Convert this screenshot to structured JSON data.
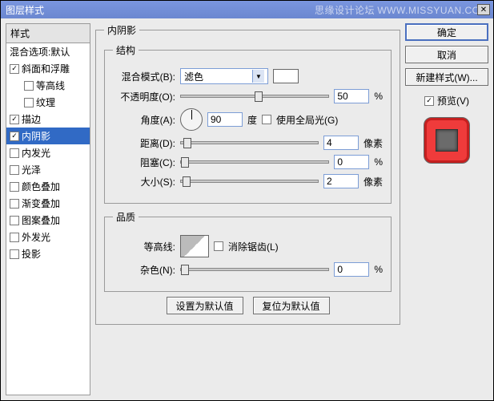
{
  "title": "图层样式",
  "watermark_text": "思缘设计论坛",
  "watermark_url": "WWW.MISSYUAN.COM",
  "styles": {
    "header": "样式",
    "blend_defaults": "混合选项:默认",
    "items": [
      {
        "label": "斜面和浮雕",
        "checked": true,
        "indent": false
      },
      {
        "label": "等高线",
        "checked": false,
        "indent": true
      },
      {
        "label": "纹理",
        "checked": false,
        "indent": true
      },
      {
        "label": "描边",
        "checked": true,
        "indent": false
      },
      {
        "label": "内阴影",
        "checked": true,
        "indent": false,
        "selected": true
      },
      {
        "label": "内发光",
        "checked": false,
        "indent": false
      },
      {
        "label": "光泽",
        "checked": false,
        "indent": false
      },
      {
        "label": "颜色叠加",
        "checked": false,
        "indent": false
      },
      {
        "label": "渐变叠加",
        "checked": false,
        "indent": false
      },
      {
        "label": "图案叠加",
        "checked": false,
        "indent": false
      },
      {
        "label": "外发光",
        "checked": false,
        "indent": false
      },
      {
        "label": "投影",
        "checked": false,
        "indent": false
      }
    ]
  },
  "panel": {
    "title": "内阴影",
    "structure": {
      "legend": "结构",
      "blend_mode_label": "混合模式(B):",
      "blend_mode_value": "滤色",
      "opacity_label": "不透明度(O):",
      "opacity_value": "50",
      "opacity_unit": "%",
      "angle_label": "角度(A):",
      "angle_value": "90",
      "angle_unit": "度",
      "global_light_label": "使用全局光(G)",
      "distance_label": "距离(D):",
      "distance_value": "4",
      "distance_unit": "像素",
      "choke_label": "阻塞(C):",
      "choke_value": "0",
      "choke_unit": "%",
      "size_label": "大小(S):",
      "size_value": "2",
      "size_unit": "像素"
    },
    "quality": {
      "legend": "品质",
      "contour_label": "等高线:",
      "antialias_label": "消除锯齿(L)",
      "noise_label": "杂色(N):",
      "noise_value": "0",
      "noise_unit": "%"
    },
    "buttons": {
      "set_default": "设置为默认值",
      "reset_default": "复位为默认值"
    }
  },
  "actions": {
    "ok": "确定",
    "cancel": "取消",
    "new_style": "新建样式(W)...",
    "preview": "预览(V)"
  }
}
